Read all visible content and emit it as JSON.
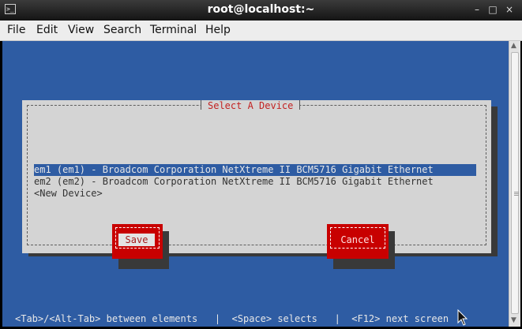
{
  "window": {
    "title": "root@localhost:~",
    "controls": {
      "minimize": "–",
      "maximize": "□",
      "close": "×"
    }
  },
  "menubar": {
    "items": [
      {
        "label": "File"
      },
      {
        "label": "Edit"
      },
      {
        "label": "View"
      },
      {
        "label": "Search"
      },
      {
        "label": "Terminal"
      },
      {
        "label": "Help"
      }
    ]
  },
  "dialog": {
    "title": "Select A Device",
    "devices": [
      {
        "label": "em1 (em1) - Broadcom Corporation NetXtreme II BCM5716 Gigabit Ethernet",
        "selected": true
      },
      {
        "label": "em2 (em2) - Broadcom Corporation NetXtreme II BCM5716 Gigabit Ethernet",
        "selected": false
      },
      {
        "label": "<New Device>",
        "selected": false
      }
    ],
    "buttons": {
      "save": "Save",
      "cancel": "Cancel"
    }
  },
  "status_line": "<Tab>/<Alt-Tab> between elements   |  <Space> selects   |  <F12> next screen",
  "colors": {
    "terminal_bg": "#2e5ca3",
    "dialog_bg": "#d4d4d4",
    "button": "#c80000",
    "title_text": "#c22222"
  }
}
